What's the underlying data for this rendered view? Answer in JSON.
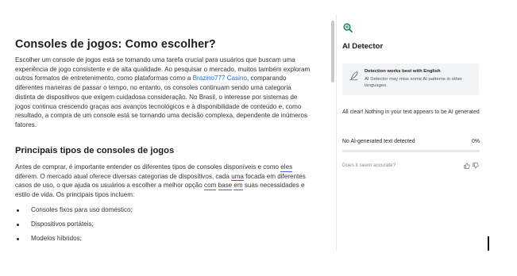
{
  "main": {
    "title": "Consoles de jogos: Como escolher?",
    "paragraph_1": [
      "Escolher um console de jogos está se tornando uma tarefa crucial para usuários que buscam uma experiência de jogo consistente e de alta qualidade. Ao pesquisar o mercado, muitos também exploram outros formatos de entretenimento, como plataformas como a ",
      "Brazino777 Casino",
      ", comparando diferentes maneiras de passar o tempo, no entanto, os consoles continuam sendo uma categoria distinta de dispositivos que exigem cuidadosa consideração. No Brasil, o interesse por sistemas de jogos continua crescendo graças aos avanços tecnológicos e à disponibilidade de conteúdo e, como resultado, a compra de um console está se tornando uma decisão complexa, dependente de inúmeros fatores."
    ],
    "subheading": "Principais tipos de consoles de jogos",
    "paragraph_2": [
      "Antes de comprar, é importante entender os diferentes tipos de consoles disponíveis e como ",
      "eles",
      " diferem. O mercado atual oferece diversas categorias de dispositivos, cada ",
      "uma",
      " focada em diferentes casos de uso, o que ajuda os usuários a escolher a melhor opção ",
      "com",
      " ",
      "base",
      " ",
      "em",
      " suas necessidades e estilo de vida. Os principais tipos incluem:"
    ],
    "bullets": [
      "Consoles fixos para uso doméstico;",
      "Dispositivos portáteis;",
      "Modelos híbridos;"
    ]
  },
  "panel": {
    "icon": "ai-detector-magnifier-icon",
    "title": "AI Detector",
    "info": {
      "icon": "pen-icon",
      "heading": "Detection works best with English",
      "body": "AI Detector may miss some AI patterns in other languages."
    },
    "verdict": "All clear! Nothing in your text appears to be AI generated",
    "result_label": "No AI-generated text detected",
    "result_value": "0%",
    "progress": 0,
    "feedback_question": "Does it seem accurate?",
    "feedback_icons": [
      "thumbs-up-icon",
      "thumbs-down-icon"
    ]
  },
  "colors": {
    "accent": "#1e8a5e",
    "link": "#1a6fd6",
    "suggestion_underline": "#3a6fe0"
  }
}
